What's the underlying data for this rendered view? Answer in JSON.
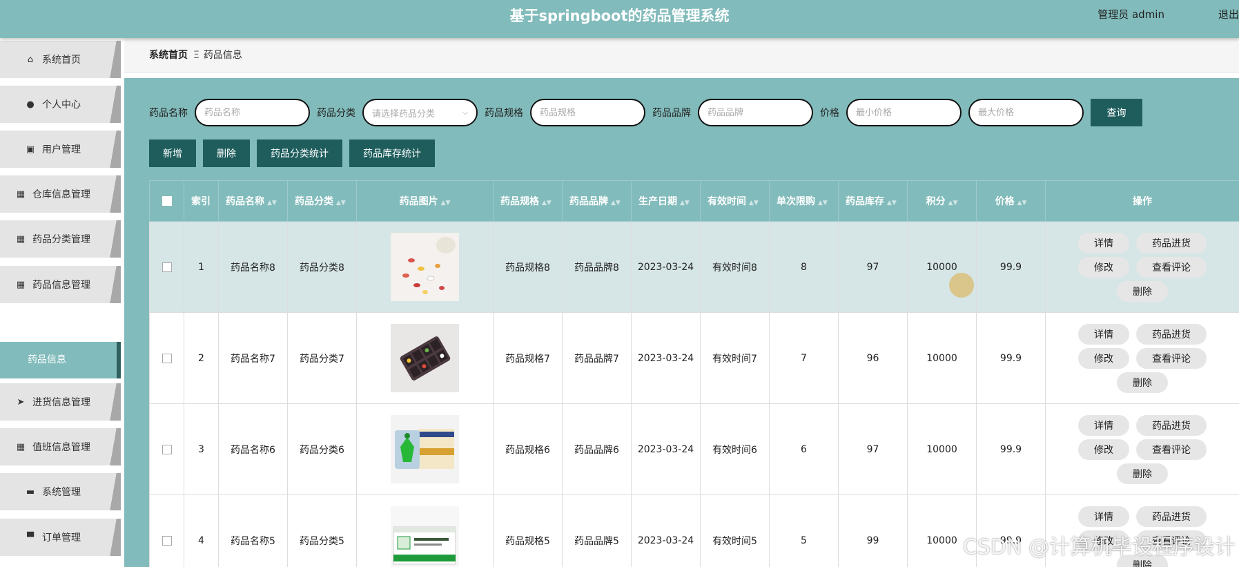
{
  "header": {
    "title": "基于springboot的药品管理系统",
    "user": "管理员 admin",
    "logout": "退出"
  },
  "sidebar": {
    "items": [
      {
        "label": "系统首页",
        "icon": "home-icon"
      },
      {
        "label": "个人中心",
        "icon": "person-icon"
      },
      {
        "label": "用户管理",
        "icon": "chart-icon"
      },
      {
        "label": "仓库信息管理",
        "icon": "grid-icon"
      },
      {
        "label": "药品分类管理",
        "icon": "grid-icon"
      },
      {
        "label": "药品信息管理",
        "icon": "grid-icon"
      },
      {
        "label": "进货信息管理",
        "icon": "send-icon"
      },
      {
        "label": "值班信息管理",
        "icon": "grid-icon"
      },
      {
        "label": "系统管理",
        "icon": "monitor-icon"
      },
      {
        "label": "订单管理",
        "icon": "printer-icon"
      }
    ],
    "active_sub": "药品信息"
  },
  "breadcrumb": {
    "home": "系统首页",
    "separator": "Ξ",
    "current": "药品信息"
  },
  "search": {
    "name_label": "药品名称",
    "name_placeholder": "药品名称",
    "category_label": "药品分类",
    "category_placeholder": "请选择药品分类",
    "spec_label": "药品规格",
    "spec_placeholder": "药品规格",
    "brand_label": "药品品牌",
    "brand_placeholder": "药品品牌",
    "price_label": "价格",
    "min_price_placeholder": "最小价格",
    "max_price_placeholder": "最大价格",
    "query_button": "查询"
  },
  "actions": {
    "add": "新增",
    "delete": "删除",
    "category_stats": "药品分类统计",
    "stock_stats": "药品库存统计"
  },
  "table": {
    "headers": [
      "索引",
      "药品名称",
      "药品分类",
      "药品图片",
      "药品规格",
      "药品品牌",
      "生产日期",
      "有效时间",
      "单次限购",
      "药品库存",
      "积分",
      "价格",
      "操作"
    ],
    "op_labels": {
      "detail": "详情",
      "restock": "药品进货",
      "edit": "修改",
      "reviews": "查看评论",
      "delete": "删除"
    },
    "rows": [
      {
        "index": "1",
        "name": "药品名称8",
        "category": "药品分类8",
        "image": "pills-image",
        "spec": "药品规格8",
        "brand": "药品品牌8",
        "date": "2023-03-24",
        "validity": "有效时间8",
        "limit": "8",
        "stock": "97",
        "points": "10000",
        "price": "99.9"
      },
      {
        "index": "2",
        "name": "药品名称7",
        "category": "药品分类7",
        "image": "pill-organizer-image",
        "spec": "药品规格7",
        "brand": "药品品牌7",
        "date": "2023-03-24",
        "validity": "有效时间7",
        "limit": "7",
        "stock": "96",
        "points": "10000",
        "price": "99.9"
      },
      {
        "index": "3",
        "name": "药品名称6",
        "category": "药品分类6",
        "image": "medicine-box-image",
        "spec": "药品规格6",
        "brand": "药品品牌6",
        "date": "2023-03-24",
        "validity": "有效时间6",
        "limit": "6",
        "stock": "97",
        "points": "10000",
        "price": "99.9"
      },
      {
        "index": "4",
        "name": "药品名称5",
        "category": "药品分类5",
        "image": "tablet-box-image",
        "spec": "药品规格5",
        "brand": "药品品牌5",
        "date": "2023-03-24",
        "validity": "有效时间5",
        "limit": "5",
        "stock": "99",
        "points": "10000",
        "price": "99.9"
      }
    ]
  },
  "watermark": "CSDN @计算机毕设程序设计",
  "colors": {
    "teal": "#82bbbb",
    "dark_teal": "#1f5d5d",
    "row_highlight": "#d6e5e5"
  }
}
